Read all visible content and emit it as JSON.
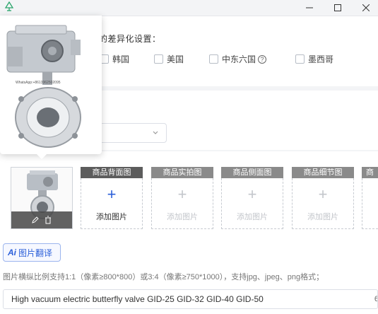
{
  "diff_settings": {
    "label": "的差异化设置：",
    "countries": [
      {
        "label": "韩国",
        "checked": false
      },
      {
        "label": "美国",
        "checked": false
      },
      {
        "label": "中东六国",
        "checked": false
      },
      {
        "label": "墨西哥",
        "checked": false
      }
    ]
  },
  "image_slots": [
    {
      "header": "商品背面图",
      "add_label": "添加图片",
      "state": "active"
    },
    {
      "header": "商品实拍图",
      "add_label": "添加图片",
      "state": "inactive"
    },
    {
      "header": "商品侧面图",
      "add_label": "添加图片",
      "state": "inactive"
    },
    {
      "header": "商品细节图",
      "add_label": "添加图片",
      "state": "inactive"
    },
    {
      "header": "商",
      "add_label": "",
      "state": "inactive"
    }
  ],
  "translate_button": {
    "ai_label": "Ai",
    "label": "图片翻译"
  },
  "hint_text": "图片横纵比例支持1:1（像素≥800*800）或3:4（像素≥750*1000），支持jpg、jpeg、png格式；",
  "title_input": {
    "value": "High vacuum electric butterfly valve GID-25 GID-32 GID-40 GID-50",
    "counter": "6"
  },
  "preview": {
    "watermark": "WhatsApp:+8613362502095"
  },
  "colors": {
    "accent": "#2b5fd9",
    "slot_header": "#5c5c5c"
  }
}
